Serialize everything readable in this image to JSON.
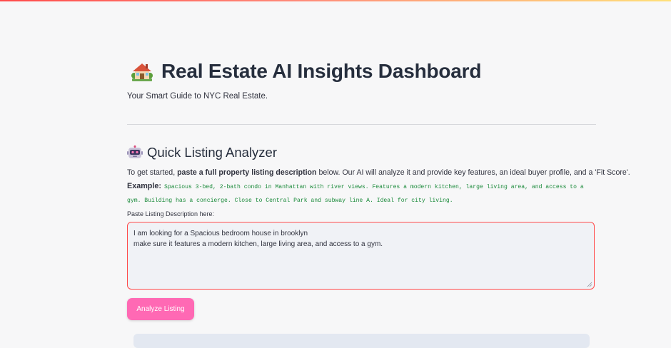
{
  "header": {
    "title": "Real Estate AI Insights Dashboard",
    "subtitle": "Your Smart Guide to NYC Real Estate.",
    "title_icon": "house-icon"
  },
  "analyzer": {
    "section_title": "Quick Listing Analyzer",
    "section_icon": "robot-icon",
    "intro_prefix": "To get started, ",
    "intro_bold": "paste a full property listing description",
    "intro_suffix": " below. Our AI will analyze it and provide key features, an ideal buyer profile, and a 'Fit Score'.",
    "example_label": "Example:",
    "example_text": "Spacious 3-bed, 2-bath condo in Manhattan with river views. Features a modern kitchen, large living area, and access to a gym. Building has a concierge. Close to Central Park and subway line A. Ideal for city living.",
    "field_label": "Paste Listing Description here:",
    "field_value": "I am looking for a Spacious  bedroom house in brooklyn\nmake sure it features a modern kitchen, large living area, and access to a gym.",
    "button_label": "Analyze Listing"
  },
  "colors": {
    "accent": "#ff4b4b",
    "button": "#ff69b4",
    "code": "#1a8a3a",
    "heading": "#262e3d"
  }
}
